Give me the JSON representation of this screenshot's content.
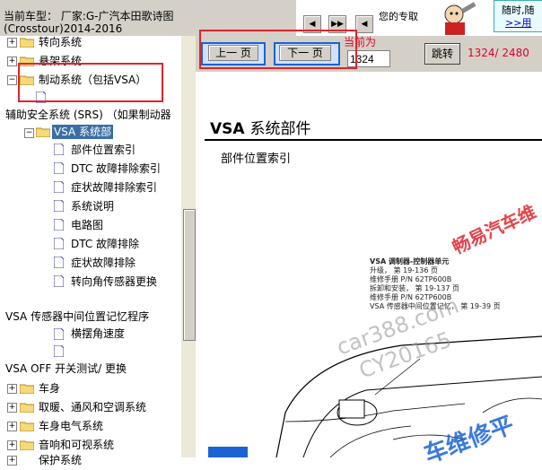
{
  "header": {
    "line1": "当前车型：  厂家:G-广汽本田歌诗图",
    "line2": "(Crosstour)2014-2016",
    "promo_text": "您的专取",
    "ad_line1": "随时,随",
    "ad_link": ">>用"
  },
  "nav_buttons": {
    "first": "◀",
    "prev": "▶▶",
    "next": "◀"
  },
  "tree": {
    "items": [
      {
        "label": "转向系统"
      },
      {
        "label": "悬架系统"
      },
      {
        "label": "制动系统（包括VSA）"
      },
      {
        "label": "辅助安全系统 (SRS) （如果制动器"
      },
      {
        "label": "VSA 系统部"
      },
      {
        "label": "部件位置索引"
      },
      {
        "label": "DTC 故障排除索引"
      },
      {
        "label": "症状故障排除索引"
      },
      {
        "label": "系统说明"
      },
      {
        "label": "电路图"
      },
      {
        "label": "DTC 故障排除"
      },
      {
        "label": "症状故障排除"
      },
      {
        "label": "转向角传感器更换"
      },
      {
        "label": "VSA 传感器中间位置记忆程序"
      },
      {
        "label": "横摆角速度"
      },
      {
        "label": "VSA OFF 开关测试/ 更换"
      },
      {
        "label": "车身"
      },
      {
        "label": "取暖、通风和空调系统"
      },
      {
        "label": "车身电气系统"
      },
      {
        "label": "音响和可视系统"
      },
      {
        "label": "保护系统"
      }
    ]
  },
  "toolbar": {
    "prev_label": "上一 页",
    "next_label": "下一 页",
    "current_label": "当前为",
    "page_value": "1324",
    "jump_label": "跳转",
    "page_count": "1324/ 2480"
  },
  "document": {
    "title_bold": "VSA",
    "title_rest": "系统部件",
    "subtitle": "部件位置索引",
    "callout": [
      "VSA 调制器-控制器单元",
      "升级， 第 19-136 页",
      "维修手册 P/N 62TP600B",
      "拆卸和安装， 第 19-137 页",
      "维修手册 P/N 62TP600B",
      "VSA 传感器中间位置记忆， 第 19-39 页"
    ]
  },
  "watermarks": {
    "w1": "畅易汽车维",
    "w2": "car388.com",
    "w3": "CY20165",
    "w4": "车维修平"
  }
}
